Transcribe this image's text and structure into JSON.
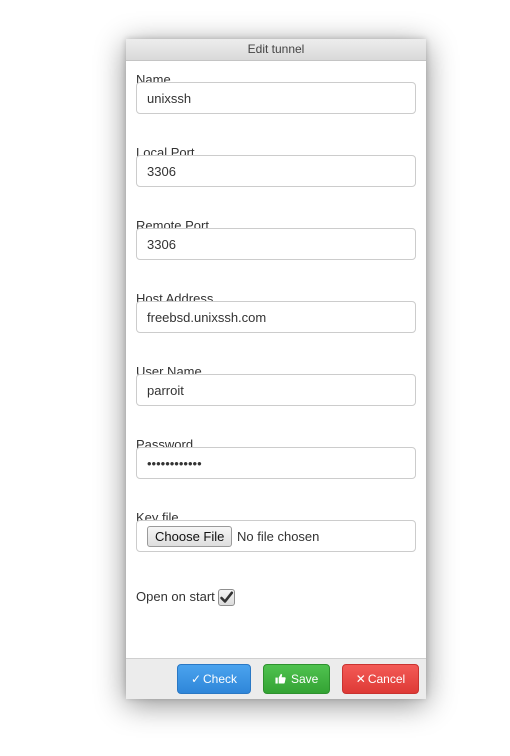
{
  "window": {
    "title": "Edit tunnel"
  },
  "form": {
    "name": {
      "label": "Name",
      "value": "unixssh"
    },
    "local_port": {
      "label": "Local Port",
      "value": "3306"
    },
    "remote_port": {
      "label": "Remote Port",
      "value": "3306"
    },
    "host_address": {
      "label": "Host Address",
      "value": "freebsd.unixssh.com"
    },
    "user_name": {
      "label": "User Name",
      "value": "parroit"
    },
    "password": {
      "label": "Password",
      "value": "••••••••••••"
    },
    "key_file": {
      "label": "Key file",
      "button_label": "Choose File",
      "status": "No file chosen"
    },
    "open_on_start": {
      "label": "Open on start",
      "checked": true,
      "check_icon": "check-mark-icon"
    }
  },
  "footer": {
    "check": {
      "label": "Check",
      "icon": "check-icon",
      "color": "#3a95e4"
    },
    "save": {
      "label": "Save",
      "icon": "thumbs-up-icon",
      "color": "#40b340"
    },
    "cancel": {
      "label": "Cancel",
      "icon": "close-icon",
      "color": "#e8473f"
    }
  }
}
